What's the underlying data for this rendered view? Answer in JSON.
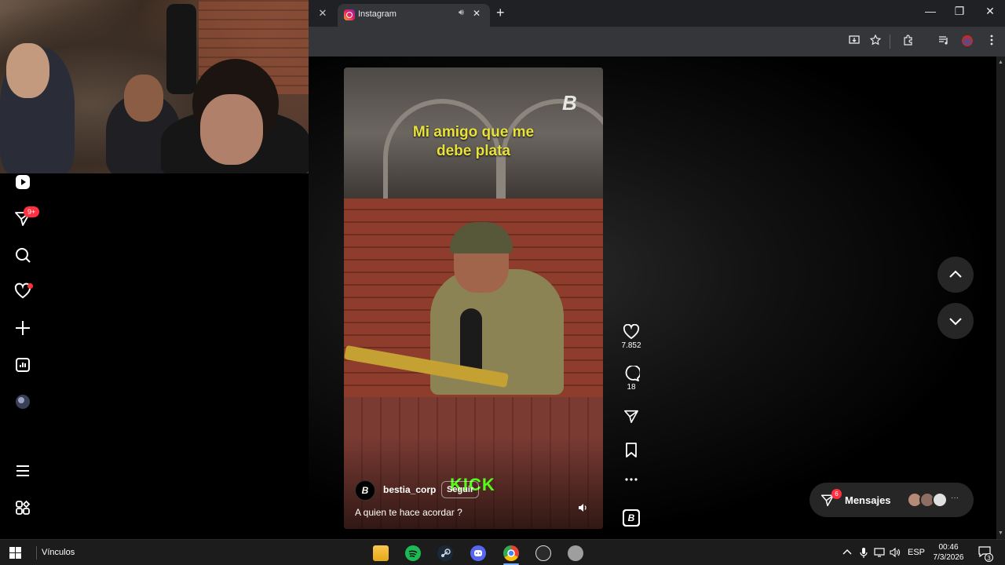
{
  "browser": {
    "tab_title": "Instagram",
    "tab_close_glyph": "✕",
    "prev_close_glyph": "✕",
    "new_tab_glyph": "+",
    "window_controls": [
      "—",
      "❐",
      "✕"
    ]
  },
  "sidebar": {
    "notifications_badge": "9+"
  },
  "reel": {
    "overlay_text_line1": "Mi amigo que me",
    "overlay_text_line2": "debe plata",
    "watermark": "B",
    "kick_text": "KICK",
    "username": "bestia_corp",
    "follow_label": "Seguir",
    "caption": "A quien te hace acordar ?",
    "avatar_letter": "B",
    "likes": "7.852",
    "comments": "18",
    "audio_letter": "B"
  },
  "messages": {
    "label": "Mensajes",
    "badge": "6",
    "more": "···"
  },
  "taskbar": {
    "pinned_label": "Vínculos",
    "language": "ESP",
    "time": "00:46",
    "date": "7/3/2026",
    "notifications": "3"
  },
  "colors": {
    "instagram_red": "#ff3040",
    "kick_green": "#53fc18",
    "caption_yellow": "#e8e33a"
  }
}
